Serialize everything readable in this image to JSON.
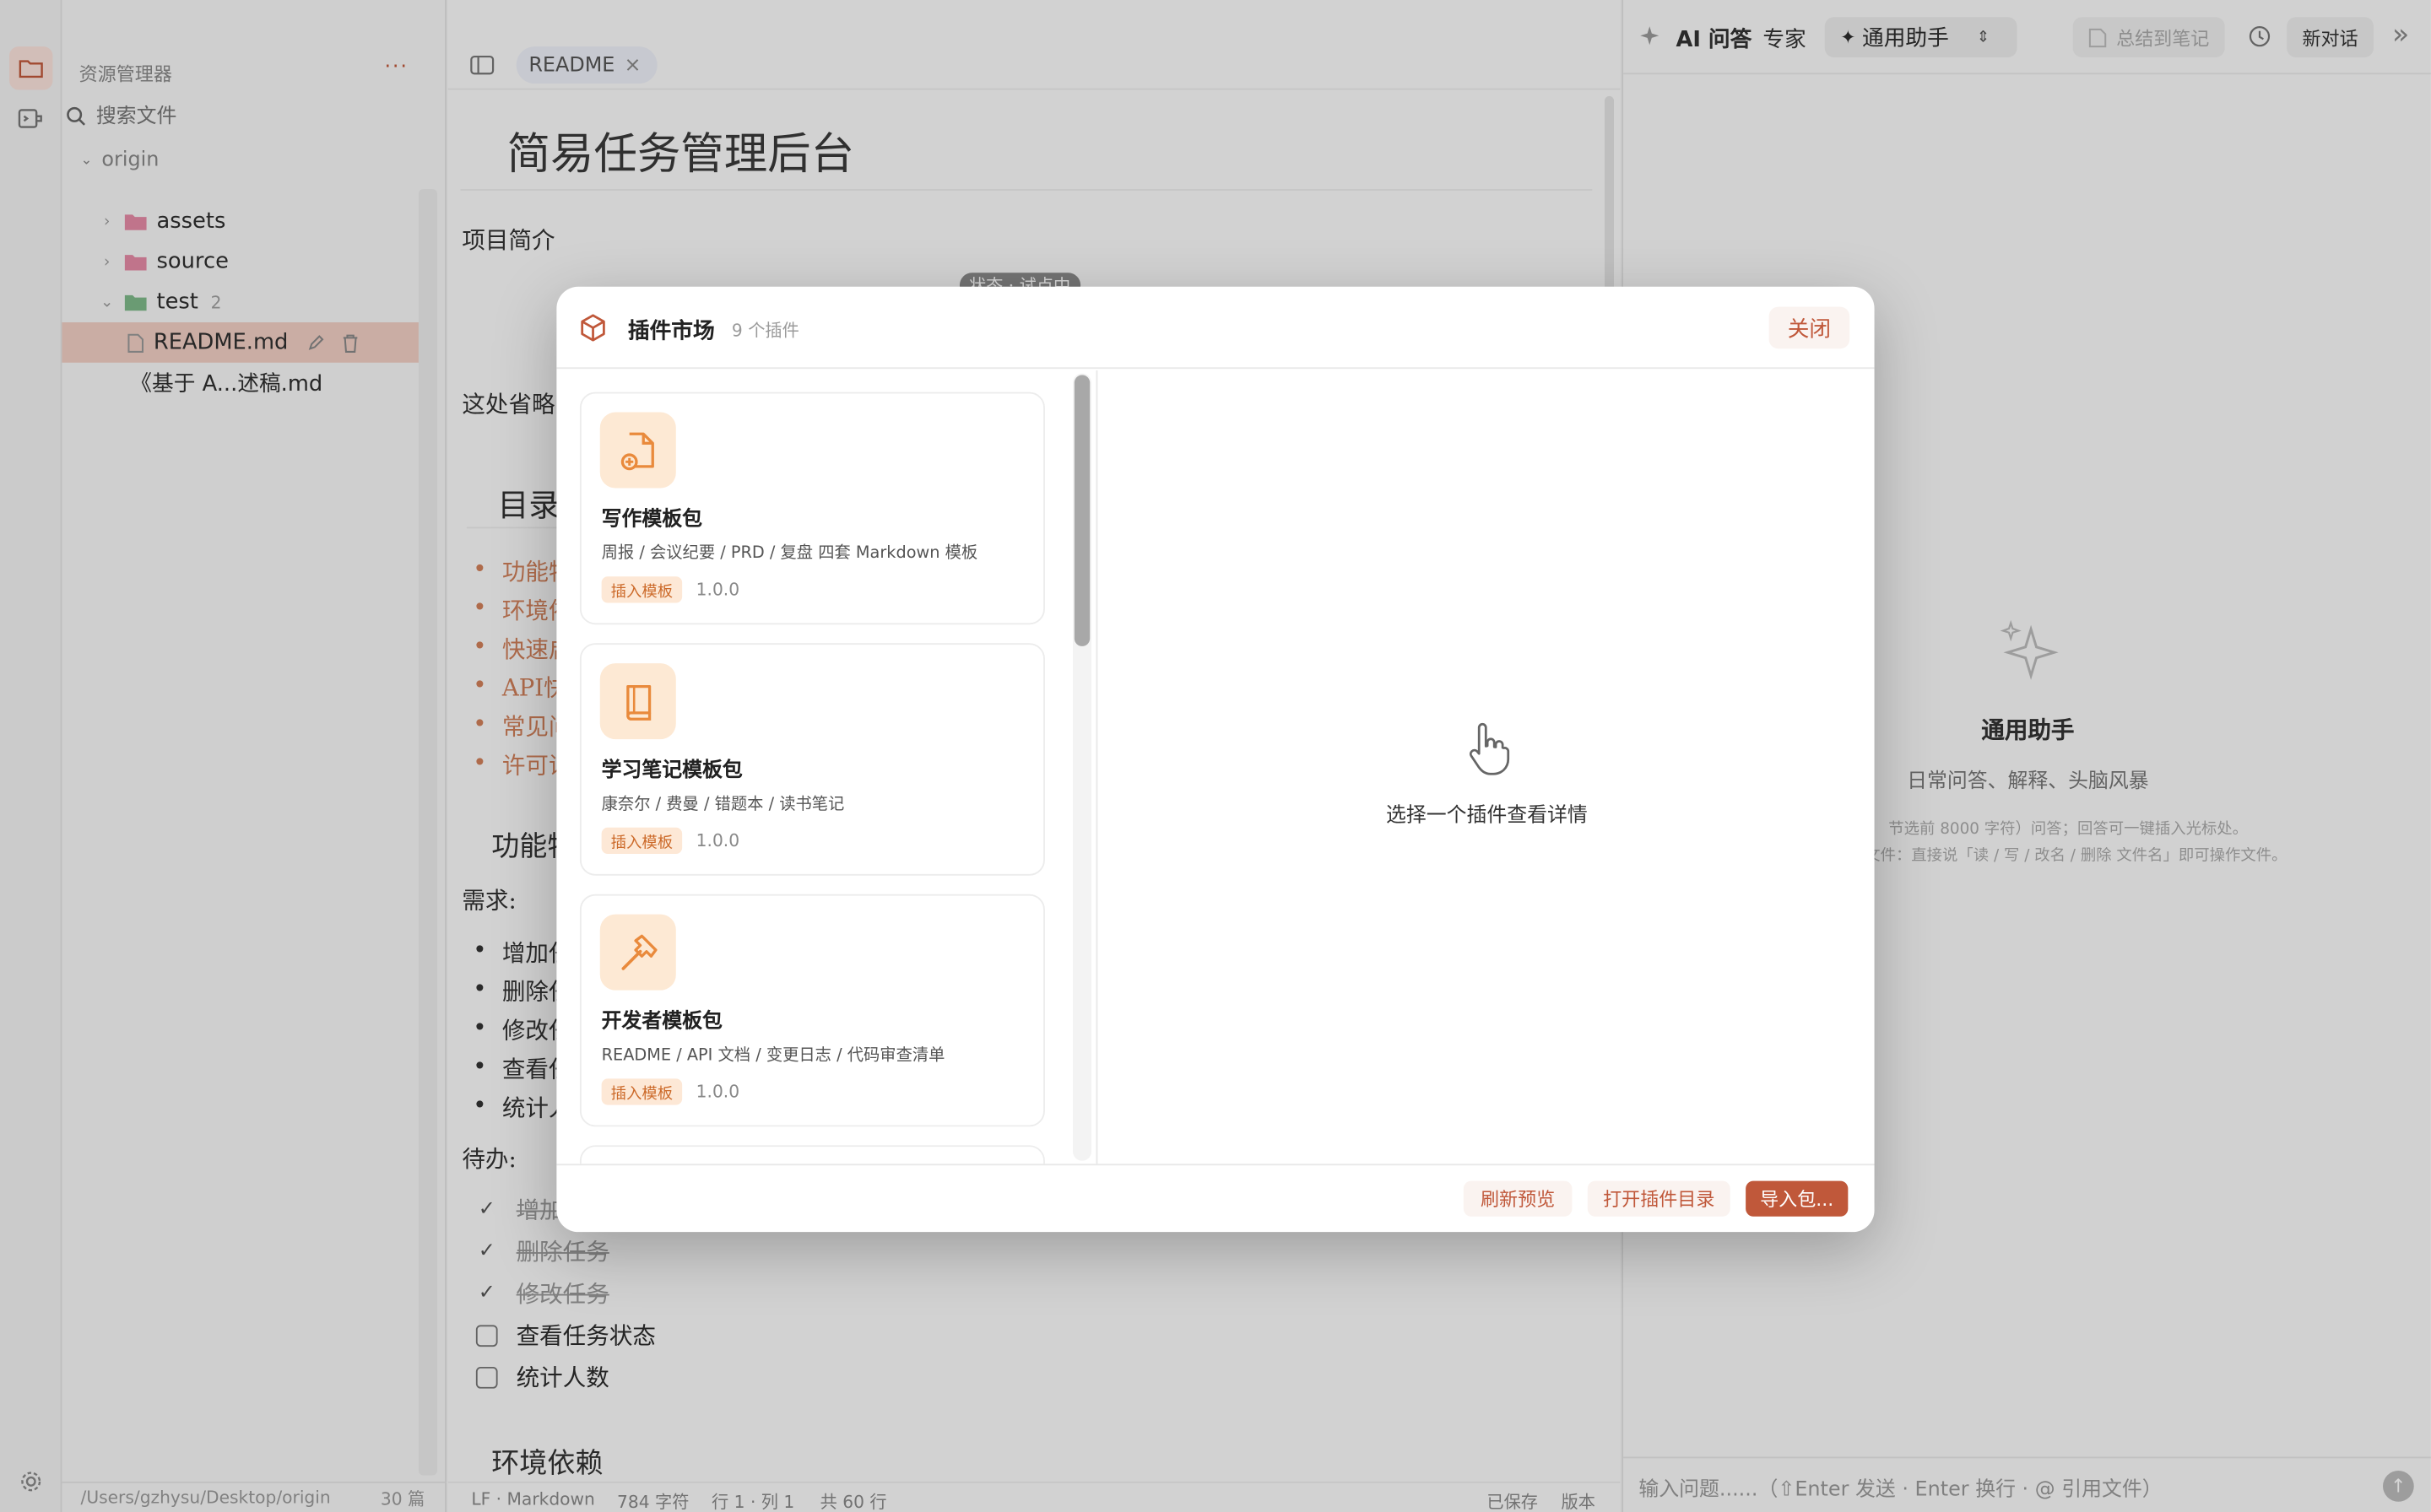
{
  "explorer": {
    "title": "资源管理器",
    "more": "···",
    "search_placeholder": "搜索文件",
    "root": "origin",
    "items": [
      {
        "label": "assets",
        "kind": "folder"
      },
      {
        "label": "source",
        "kind": "folder"
      },
      {
        "label": "test",
        "kind": "folder",
        "count": "2"
      },
      {
        "label": "README.md",
        "kind": "file"
      },
      {
        "label": "《基于 A...述稿.md",
        "kind": "file"
      }
    ],
    "status_path": "/Users/gzhysu/Desktop/origin",
    "status_count": "30 篇"
  },
  "editor": {
    "tab_label": "README",
    "tab_close": "×",
    "doc_title": "简易任务管理后台",
    "intro_heading": "项目简介",
    "badge": "状态 · 试点中",
    "body_partial": "这处省略",
    "toc_heading": "目录",
    "toc_items": [
      "功能特",
      "环境依",
      "快速启",
      "API快",
      "常见问",
      "许可证"
    ],
    "features_heading": "功能特",
    "needs_label": "需求:",
    "needs_items": [
      "增加任",
      "删除任",
      "修改任",
      "查看任",
      "统计人"
    ],
    "todo_label": "待办:",
    "todos": [
      {
        "text": "增加",
        "done": true
      },
      {
        "text": "删除任务",
        "done": true
      },
      {
        "text": "修改任务",
        "done": true
      },
      {
        "text": "查看任务状态",
        "done": false
      },
      {
        "text": "统计人数",
        "done": false
      }
    ],
    "env_heading": "环境依赖",
    "status": {
      "eol": "LF · Markdown",
      "chars": "784 字符",
      "pos": "行 1 · 列 1",
      "lines": "共 60 行",
      "saved": "已保存",
      "version": "版本"
    }
  },
  "ai": {
    "title": "AI 问答",
    "expert": "专家",
    "assistant": "通用助手",
    "summarize": "总结到笔记",
    "new_chat": "新对话",
    "hero_title": "通用助手",
    "hero_sub": "日常问答、解释、头脑风暴",
    "hint1": "节选前 8000 字符）问答；回答可一键插入光标处。",
    "hint2": "件文件：直接说「读 / 写 / 改名 / 删除 文件名」即可操作文件。",
    "input_placeholder": "输入问题......（⇧Enter 发送 · Enter 换行 · @ 引用文件）"
  },
  "modal": {
    "title": "插件市场",
    "count": "9 个插件",
    "close": "关闭",
    "plugins": [
      {
        "name": "写作模板包",
        "desc": "周报 / 会议纪要 / PRD / 复盘 四套 Markdown 模板",
        "tag": "插入模板",
        "version": "1.0.0",
        "icon": "file-plus-icon"
      },
      {
        "name": "学习笔记模板包",
        "desc": "康奈尔 / 费曼 / 错题本 / 读书笔记",
        "tag": "插入模板",
        "version": "1.0.0",
        "icon": "book-icon"
      },
      {
        "name": "开发者模板包",
        "desc": "README / API 文档 / 变更日志 / 代码审查清单",
        "tag": "插入模板",
        "version": "1.0.0",
        "icon": "hammer-icon"
      }
    ],
    "empty_text": "选择一个插件查看详情",
    "footer": {
      "refresh": "刷新预览",
      "open_dir": "打开插件目录",
      "import": "导入包..."
    }
  },
  "colors": {
    "accent": "#c0583a",
    "accent_bg": "#fde9d4",
    "selected_row": "#f1cfc4"
  }
}
